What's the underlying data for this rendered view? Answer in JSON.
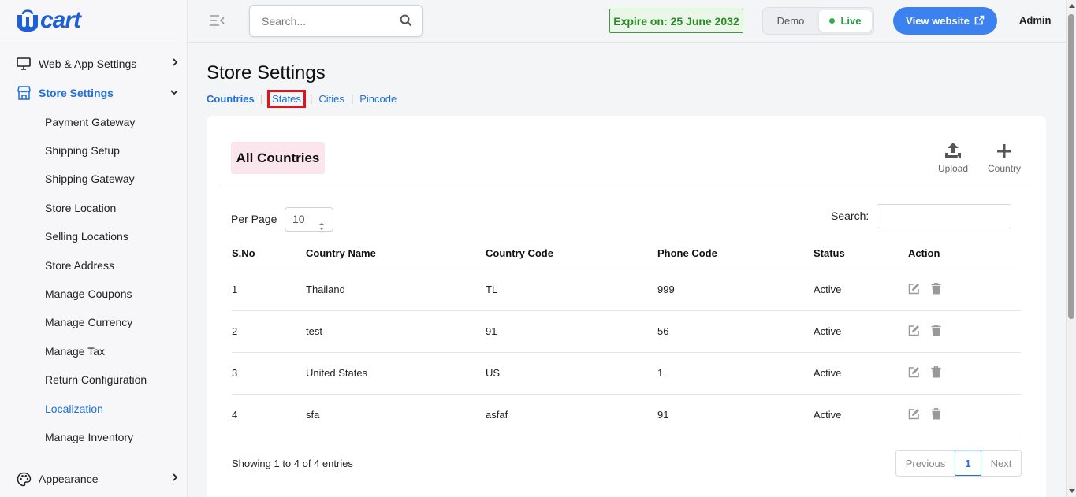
{
  "brand": {
    "logo_text": "cart",
    "logo_color": "#1c5fd6"
  },
  "search": {
    "placeholder": "Search..."
  },
  "header": {
    "expire_label": "Expire on: 25 June 2032",
    "toggle_demo": "Demo",
    "toggle_live": "Live",
    "view_website": "View website",
    "user": "Admin"
  },
  "sidebar": {
    "sections": [
      {
        "label": "Web & App Settings",
        "icon": "monitor-icon",
        "expanded": false
      },
      {
        "label": "Store Settings",
        "icon": "store-icon",
        "expanded": true
      },
      {
        "label": "Appearance",
        "icon": "palette-icon",
        "expanded": false
      }
    ],
    "sub_items": [
      "Payment Gateway",
      "Shipping Setup",
      "Shipping Gateway",
      "Store Location",
      "Selling Locations",
      "Store Address",
      "Manage Coupons",
      "Manage Currency",
      "Manage Tax",
      "Return Configuration",
      "Localization",
      "Manage Inventory"
    ],
    "active_sub_item": "Localization"
  },
  "page": {
    "title": "Store Settings",
    "tabs": [
      "Countries",
      "States",
      "Cities",
      "Pincode"
    ],
    "active_tab": "Countries",
    "highlighted_tab": "States"
  },
  "card": {
    "title": "All Countries",
    "tools": [
      {
        "label": "Upload",
        "icon": "upload-icon"
      },
      {
        "label": "Country",
        "icon": "plus-icon"
      }
    ],
    "per_page_label": "Per Page",
    "per_page_value": "10",
    "search_label": "Search:"
  },
  "table": {
    "columns": [
      "S.No",
      "Country Name",
      "Country Code",
      "Phone Code",
      "Status",
      "Action"
    ],
    "rows": [
      {
        "sno": "1",
        "name": "Thailand",
        "code": "TL",
        "phone": "999",
        "status": "Active"
      },
      {
        "sno": "2",
        "name": "test",
        "code": "91",
        "phone": "56",
        "status": "Active"
      },
      {
        "sno": "3",
        "name": "United States",
        "code": "US",
        "phone": "1",
        "status": "Active"
      },
      {
        "sno": "4",
        "name": "sfa",
        "code": "asfaf",
        "phone": "91",
        "status": "Active"
      }
    ]
  },
  "pagination": {
    "showing": "Showing 1 to 4 of 4 entries",
    "previous": "Previous",
    "current": "1",
    "next": "Next"
  },
  "colors": {
    "accent": "#1c6fdc",
    "expire_green": "#2a8a2a",
    "highlight_red": "#e0141b",
    "card_title_bg": "#fbe6ee",
    "view_btn": "#3b82f0"
  }
}
